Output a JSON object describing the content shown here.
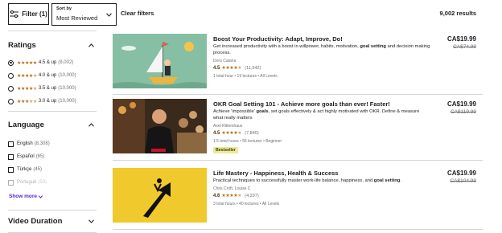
{
  "toolbar": {
    "filter_label": "Filter (1)",
    "sort_label": "Sort by",
    "sort_value": "Most Reviewed",
    "clear_label": "Clear filters",
    "results": "9,002 results"
  },
  "sidebar": {
    "ratings_title": "Ratings",
    "ratings": [
      {
        "label": "4.5 & up",
        "count": "(9,002)",
        "selected": true,
        "full": 4,
        "half": true
      },
      {
        "label": "4.0 & up",
        "count": "(10,000)",
        "selected": false,
        "full": 4,
        "half": false
      },
      {
        "label": "3.5 & up",
        "count": "(10,000)",
        "selected": false,
        "full": 3,
        "half": true
      },
      {
        "label": "3.0 & up",
        "count": "(10,000)",
        "selected": false,
        "full": 3,
        "half": false
      }
    ],
    "language_title": "Language",
    "languages": [
      {
        "label": "English",
        "count": "(8,308)"
      },
      {
        "label": "Español",
        "count": "(65)"
      },
      {
        "label": "Türkçe",
        "count": "(45)"
      },
      {
        "label": "Portuguê",
        "count": "(59)"
      }
    ],
    "show_more": "Show more",
    "video_title": "Video Duration"
  },
  "courses": [
    {
      "title": "Boost Your Productivity: Adapt, Improve, Do!",
      "desc_a": "Get increased productivity with a boost in willpower, habits, motivation, ",
      "desc_bold": "goal setting",
      "desc_b": " and decision making process.",
      "instructor": "Dorú Catana",
      "rating": "4.5",
      "reviews": "(11,542)",
      "meta": "1 total hour • 19 lectures • All Levels",
      "price": "CA$19.99",
      "old_price": "CA$74.99"
    },
    {
      "title": "OKR Goal Setting 101 - Achieve more goals than ever! Faster!",
      "desc_a": "Achieve 'impossible' ",
      "desc_bold": "goals",
      "desc_b": ", set goals effectively & act highly motivated with OKR. Define & measure what really matters",
      "instructor": "Axel Rittershaus",
      "rating": "4.5",
      "reviews": "(7,840)",
      "meta": "1.5 total hours • 56 lectures • Beginner",
      "badge": "Bestseller",
      "price": "CA$19.99",
      "old_price": "CA$119.99"
    },
    {
      "title": "Life Mastery - Happiness, Health & Success",
      "desc_a": "Practical techniques to successfully master work-life balance, happiness, and ",
      "desc_bold": "goal setting",
      "desc_b": ".",
      "instructor": "Chris Croft, Louise C",
      "rating": "4.6",
      "reviews": "(4,297)",
      "meta": "3 total hours • 40 lectures • All Levels",
      "price": "CA$19.99",
      "old_price": "CA$104.99"
    }
  ],
  "colors": {
    "accent": "#5624d0",
    "star": "#b4690e",
    "bestseller_bg": "#eceb98",
    "thumb1_bg": "#86bfa4",
    "thumb3_bg": "#f0c92c"
  },
  "icons": {
    "filter": "filter-sliders-icon",
    "sort_chevron": "chevron-down-icon",
    "section_toggle": "chevron-up-icon",
    "show_more": "chevron-down-icon"
  }
}
